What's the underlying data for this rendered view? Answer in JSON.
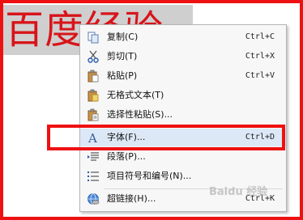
{
  "document": {
    "text": "百度经验"
  },
  "context_menu": {
    "items": [
      {
        "label": "复制(C)",
        "shortcut": "Ctrl+C",
        "icon": "copy-icon"
      },
      {
        "label": "剪切(T)",
        "shortcut": "Ctrl+X",
        "icon": "scissors-icon"
      },
      {
        "label": "粘贴(P)",
        "shortcut": "Ctrl+V",
        "icon": "paste-icon"
      },
      {
        "label": "无格式文本(T)",
        "shortcut": "",
        "icon": "paste-plain-text-icon"
      },
      {
        "label": "选择性粘贴(S)...",
        "shortcut": "",
        "icon": "paste-special-icon"
      },
      {
        "label": "字体(F)...",
        "shortcut": "Ctrl+D",
        "icon": "font-icon"
      },
      {
        "label": "段落(P)...",
        "shortcut": "",
        "icon": "paragraph-icon"
      },
      {
        "label": "项目符号和编号(N)...",
        "shortcut": "",
        "icon": "bullets-icon"
      },
      {
        "label": "超链接(H)...",
        "shortcut": "Ctrl+K",
        "icon": "hyperlink-icon"
      }
    ],
    "highlighted_item": "字体(F)..."
  },
  "watermark": {
    "text": "Baidu 经验"
  },
  "colors": {
    "annotation_red": "#ee1111",
    "document_text_red": "#d8141a",
    "banner_gray": "#cfcfcf"
  }
}
